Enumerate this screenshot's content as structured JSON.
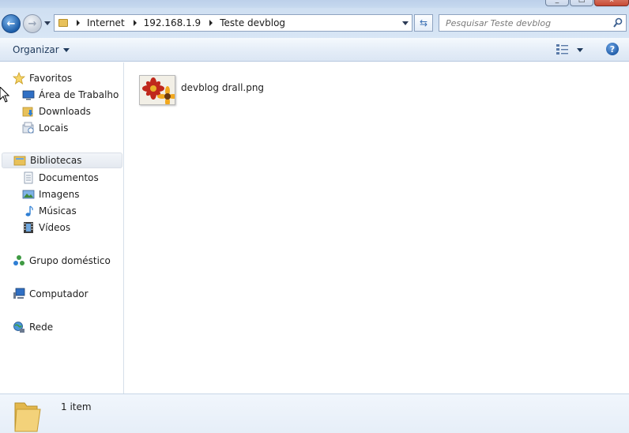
{
  "window": {
    "buttons": [
      "minimize-icon",
      "maximize-icon",
      "close-icon"
    ]
  },
  "navigation": {
    "breadcrumb": [
      "Internet",
      "192.168.1.9",
      "Teste devblog"
    ],
    "search_placeholder": "Pesquisar Teste devblog"
  },
  "toolbar": {
    "organize_label": "Organizar"
  },
  "sidebar": {
    "favorites": {
      "label": "Favoritos",
      "items": [
        {
          "label": "Área de Trabalho",
          "icon": "desktop-icon"
        },
        {
          "label": "Downloads",
          "icon": "downloads-icon"
        },
        {
          "label": "Locais",
          "icon": "recent-places-icon"
        }
      ]
    },
    "libraries": {
      "label": "Bibliotecas",
      "items": [
        {
          "label": "Documentos",
          "icon": "documents-icon"
        },
        {
          "label": "Imagens",
          "icon": "pictures-icon"
        },
        {
          "label": "Músicas",
          "icon": "music-icon"
        },
        {
          "label": "Vídeos",
          "icon": "videos-icon"
        }
      ]
    },
    "homegroup": {
      "label": "Grupo doméstico"
    },
    "computer": {
      "label": "Computador"
    },
    "network": {
      "label": "Rede"
    }
  },
  "files": [
    {
      "name": "devblog drall.png",
      "icon": "image-file-icon"
    }
  ],
  "status": {
    "item_count": "1 item"
  },
  "colors": {
    "nav_background": "#d3e2f4",
    "selected_item": "#e6ebf2",
    "details_background": "#eaf1f9"
  }
}
